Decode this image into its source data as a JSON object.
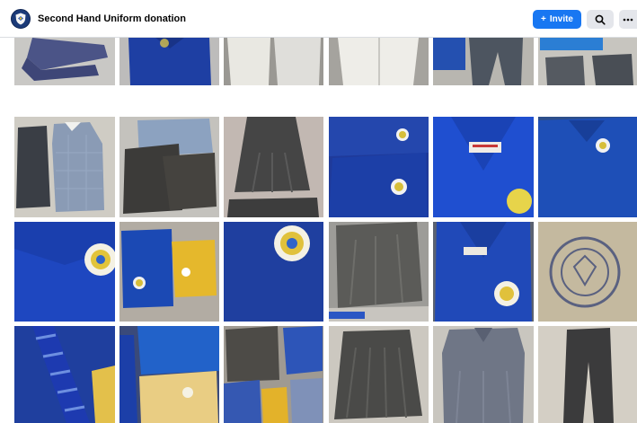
{
  "header": {
    "group_name": "Second Hand Uniform donation",
    "invite_label": "Invite",
    "avatar_icon": "school-crest-icon",
    "search_icon": "search-icon",
    "more_icon": "more-icon"
  },
  "photos": [
    {
      "name": "photo-navy-trousers"
    },
    {
      "name": "photo-blue-polo"
    },
    {
      "name": "photo-white-blouses"
    },
    {
      "name": "photo-white-shirt"
    },
    {
      "name": "photo-blue-polo-and-grey-trousers"
    },
    {
      "name": "photo-blue-polo-and-grey-shorts"
    },
    {
      "name": "photo-pinafore-and-checked-dress"
    },
    {
      "name": "photo-grey-pinafores"
    },
    {
      "name": "photo-grey-skirt"
    },
    {
      "name": "photo-blue-polos-with-crest"
    },
    {
      "name": "photo-blue-jumper-label"
    },
    {
      "name": "photo-blue-sweatshirt"
    },
    {
      "name": "photo-blue-jumper-crest-closeup"
    },
    {
      "name": "photo-book-bag-and-yellow-tops"
    },
    {
      "name": "photo-blue-crest-closeup"
    },
    {
      "name": "photo-grey-skirt-folded"
    },
    {
      "name": "photo-blue-jumper-with-crest"
    },
    {
      "name": "photo-beige-bag-with-crest"
    },
    {
      "name": "photo-blue-striped-ties"
    },
    {
      "name": "photo-ties-and-yellow-shirt"
    },
    {
      "name": "photo-mixed-grey-and-blue-clothes"
    },
    {
      "name": "photo-grey-pleated-skirt"
    },
    {
      "name": "photo-grey-dress"
    },
    {
      "name": "photo-grey-trousers"
    }
  ],
  "colors": {
    "primary": "#1877f2",
    "header_bg": "#ffffff",
    "grid_bg": "#ffffff"
  }
}
